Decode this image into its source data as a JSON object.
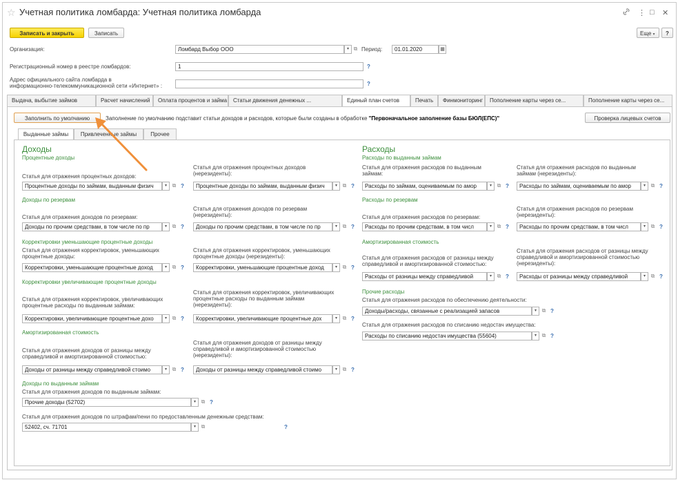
{
  "window": {
    "title": "Учетная политика ломбарда: Учетная политика ломбарда"
  },
  "toolbar": {
    "save_close": "Записать и закрыть",
    "save": "Записать",
    "more": "Еще",
    "more_arrow": "▾",
    "help": "?"
  },
  "header": {
    "org_label": "Организация:",
    "org_value": "Ломбард Выбор ООО",
    "period_label": "Период:",
    "period_value": "01.01.2020",
    "reg_label": "Регистрационный номер в реестре ломбардов:",
    "reg_value": "1",
    "site_label_1": "Адрес официального сайта ломбарда в",
    "site_label_2": "информационно-телекоммуникационной сети «Интернет» :",
    "site_value": ""
  },
  "tabs": [
    "Выдача, выбытие займов",
    "Расчет начислений",
    "Оплата процентов и займа б...",
    "Статьи движения денежных ...",
    "Единый план счетов",
    "Печать",
    "Финмониторинг",
    "Пополнение карты через се...",
    "Пополнение карты через се..."
  ],
  "eps": {
    "fill_default": "Заполнить по умолчанию",
    "info_text": "Заполнение по умолчанию подставит статьи доходов и расходов, которые были созданы в обработке ",
    "info_bold": "\"Первоначальное заполнение базы БЮЛ(ЕПС)\"",
    "check_accounts": "Проверка лицевых счетов"
  },
  "subtabs": [
    "Выданные займы",
    "Привлеченные займы",
    "Прочее"
  ],
  "income": {
    "title": "Доходы",
    "s1": "Процентные доходы",
    "s1_l1": "Статья для отражения процентных доходов:",
    "s1_v1": "Процентные доходы по займам, выданным физич",
    "s1_l2a": "Статья для отражения процентных доходов",
    "s1_l2b": "(нерезиденты):",
    "s1_v2": "Процентные доходы по займам, выданным физич",
    "s2": "Доходы по резервам",
    "s2_l1": "Статья для отражения доходов по резервам:",
    "s2_v1": "Доходы по прочим средствам, в том числе по пр",
    "s2_l2a": "Статья для отражения доходов по резервам",
    "s2_l2b": "(нерезиденты):",
    "s2_v2": "Доходы по прочим средствам, в том числе по пр",
    "s3": "Корректировки уменьшающие процентные доходы",
    "s3_l1a": "Статья для отражения корректировок, уменьшающих",
    "s3_l1b": "процентные доходы:",
    "s3_v1": "Корректировки, уменьшающие процентные доход",
    "s3_l2a": "Статья для отражения корректировок, уменьшающих",
    "s3_l2b": "процентные доходы (нерезиденты):",
    "s3_v2": "Корректировки, уменьшающие процентные доход",
    "s4": "Корректировки увеличивающие процентные доходы",
    "s4_l1a": "Статья для отражения корректировок, увеличивающих",
    "s4_l1b": "процентные расходы по выданным займам:",
    "s4_v1": "Корректировки, увеличивающие процентные дохо",
    "s4_l2a": "Статья для отражения корректировок, увеличивающих",
    "s4_l2b": "процентные расходы по выданным займам",
    "s4_l2c": "(нерезиденты):",
    "s4_v2": "Корректировки, увеличивающие процентные дох",
    "s5": "Амортизированная стоимость",
    "s5_l1a": "Статья для отражения доходов от разницы между",
    "s5_l1b": "справедливой и амортизированной стоимостью:",
    "s5_v1": "Доходы от разницы между справедливой стоимо",
    "s5_l2a": "Статья для отражения доходов от разницы между",
    "s5_l2b": "справедливой и амортизированной стоимостью",
    "s5_l2c": "(нерезиденты):",
    "s5_v2": "Доходы от разницы между справедливой стоимо",
    "s6": "Доходы по выданным займам",
    "s6_l1": "Статья для отражения доходов по выданным займам:",
    "s6_v1": "Прочие доходы (52702)",
    "s6_l2": "Статья для отражения доходов по штрафам/пени по предоставленным денежным средствам:",
    "s6_v2": "52402, сч. 71701"
  },
  "expense": {
    "title": "Расходы",
    "s1": "Расходы по выданным займам",
    "s1_l1a": "Статья для отражения расходов по выданным",
    "s1_l1b": "займам:",
    "s1_v1": "Расходы по займам, оцениваемым по амор",
    "s1_l2a": "Статья для отражения расходов по выданным",
    "s1_l2b": "займам (нерезиденты):",
    "s1_v2": "Расходы по займам, оцениваемым по амор",
    "s2": "Расходы по резервам",
    "s2_l1": "Статья для отражения расходов по резервам:",
    "s2_v1": "Расходы по прочим средствам, в том числ",
    "s2_l2a": "Статья для отражения расходов по резервам",
    "s2_l2b": "(нерезиденты):",
    "s2_v2": "Расходы по прочим средствам, в том числ",
    "s3": "Амортизированная стоимость",
    "s3_l1a": "Статья для отражения расходов от разницы между",
    "s3_l1b": "справедливой и амортизированной стоимостью:",
    "s3_v1": "Расходы от разницы между справедливой",
    "s3_l2a": "Статья для отражения расходов от разницы между",
    "s3_l2b": "справедливой и амортизированной стоимостью",
    "s3_l2c": "(нерезиденты):",
    "s3_v2": "Расходы от разницы между справедливой",
    "s4": "Прочие расходы",
    "s4_l1": "Статья для отражения расходов по обеспечению деятельности:",
    "s4_v1": "Доходы/расходы, связанные с реализацией запасов",
    "s4_l2": "Статья для отражения расходов по списанию недостач имущества:",
    "s4_v2": "Расходы по списанию недостач имущества (55604)"
  },
  "glyphs": {
    "dd": "▾",
    "link": "⧉",
    "q": "?",
    "cal": "▦",
    "star": "☆",
    "dots": "⋮",
    "restore": "□",
    "close": "✕",
    "chain": "🔗"
  },
  "colors": {
    "accent_yellow": "#f6d200",
    "section_green": "#3d8f3d",
    "help_blue": "#3a6fb0",
    "annotation_arrow": "#f0903a"
  }
}
